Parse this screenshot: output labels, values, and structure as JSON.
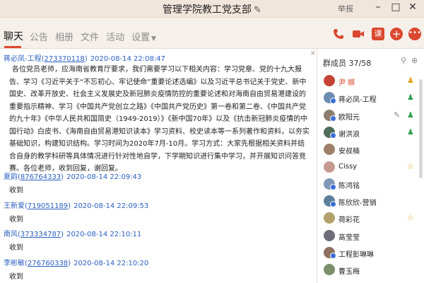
{
  "window": {
    "title": "管理学院教工党支部",
    "edit_icon": "pencil-icon",
    "report_label": "举报",
    "controls": [
      "minimize-icon",
      "maximize-icon",
      "close-icon"
    ]
  },
  "tabs": [
    {
      "label": "聊天",
      "active": true
    },
    {
      "label": "公告",
      "active": false
    },
    {
      "label": "相册",
      "active": false
    },
    {
      "label": "文件",
      "active": false
    },
    {
      "label": "活动",
      "active": false
    },
    {
      "label": "设置",
      "active": false
    }
  ],
  "toolbar_icons": [
    "phone-icon",
    "video-icon",
    "course-icon",
    "add-icon",
    "more-icon"
  ],
  "toolbar_course_label": "课",
  "messages": [
    {
      "name": "蒋必凤-工程",
      "qq": "273370118",
      "time": "2020-08-14 22:08:47",
      "body": "各位党员老师，应海南省教育厅要求，我们需要学习以下相关内容：学习党章、党的十九大报告、学习《习近平关于“不忘初心、牢记使命”重要论述选编》以及习近平总书记关于党史、新中国史、改革开放史、社会主义发展史及新冠肺炎疫情防控的重要论述和对海南自由贸易港建设的重要指示精神、学习《中国共产党创立之路》《中国共产党历史》第一卷和第二卷、《中国共产党的九十年》《中华人民共和国简史（1949-2019）》《新中国70年》以及《抗击新冠肺炎疫情的中国行动》白皮书、《海南自由贸易港知识读本》学习资料、校史读本等一系列著作和资料，以夯实基础知识，构建知识结构。学习时间为2020年7月-10月。学习方式：大家先根据相关资料并结合自身的教学科研等具体情况进行针对性地自学，下学期知识进行集中学习，并开展知识问答竞赛。各位老师，收到回复，谢回复。"
    },
    {
      "name": "夏韵",
      "qq": "876764333",
      "time": "2020-08-14 22:09:43",
      "body": "收到"
    },
    {
      "name": "王新爱",
      "qq": "719051189",
      "time": "2020-08-14 22:09:53",
      "body": "收到"
    },
    {
      "name": "南风",
      "qq": "373334787",
      "time": "2020-08-14 22:10:11",
      "body": "收到"
    },
    {
      "name": "李彬敏",
      "qq": "276760338",
      "time": "2020-08-14 22:10:20",
      "body": "收到"
    }
  ],
  "members": {
    "label": "群成员",
    "count": "37/58",
    "header_icons": [
      "search-icon",
      "add-member-icon"
    ],
    "list": [
      {
        "name": "尹 娜",
        "owner": true,
        "role": "owner",
        "avatar_color": "#c44536",
        "badge": false
      },
      {
        "name": "蒋必凤-工程",
        "owner": false,
        "role": "admin",
        "avatar_color": "#6b8cae",
        "badge": true
      },
      {
        "name": "欧阳元",
        "owner": false,
        "role": "admin-edit",
        "avatar_color": "#8a7d6b",
        "badge": true
      },
      {
        "name": "谢洪浪",
        "owner": false,
        "role": "admin",
        "avatar_color": "#4f6d5a",
        "badge": true
      },
      {
        "name": "安叔楠",
        "owner": false,
        "role": "",
        "avatar_color": "#a0806a",
        "badge": false
      },
      {
        "name": "Cissy",
        "owner": false,
        "role": "star",
        "avatar_color": "#c79a8f",
        "badge": false
      },
      {
        "name": "陈鸿铭",
        "owner": false,
        "role": "",
        "avatar_color": "#7f98b9",
        "badge": true
      },
      {
        "name": "陈欣欣-营销",
        "owner": false,
        "role": "",
        "avatar_color": "#5d7f9e",
        "badge": true
      },
      {
        "name": "荷彩花",
        "owner": false,
        "role": "star",
        "avatar_color": "#b3a06a",
        "badge": false
      },
      {
        "name": "高莹莹",
        "owner": false,
        "role": "",
        "avatar_color": "#6d6d7a",
        "badge": false
      },
      {
        "name": "工程彭琳琳",
        "owner": false,
        "role": "",
        "avatar_color": "#8f6f5f",
        "badge": true
      },
      {
        "name": "曹玉梅",
        "owner": false,
        "role": "",
        "avatar_color": "#7a8f6a",
        "badge": false
      }
    ]
  },
  "colors": {
    "accent_red": "#d9482f",
    "link_blue": "#2b5fc0",
    "admin_green": "#2e9e4f",
    "star_gold": "#e0a21b"
  }
}
